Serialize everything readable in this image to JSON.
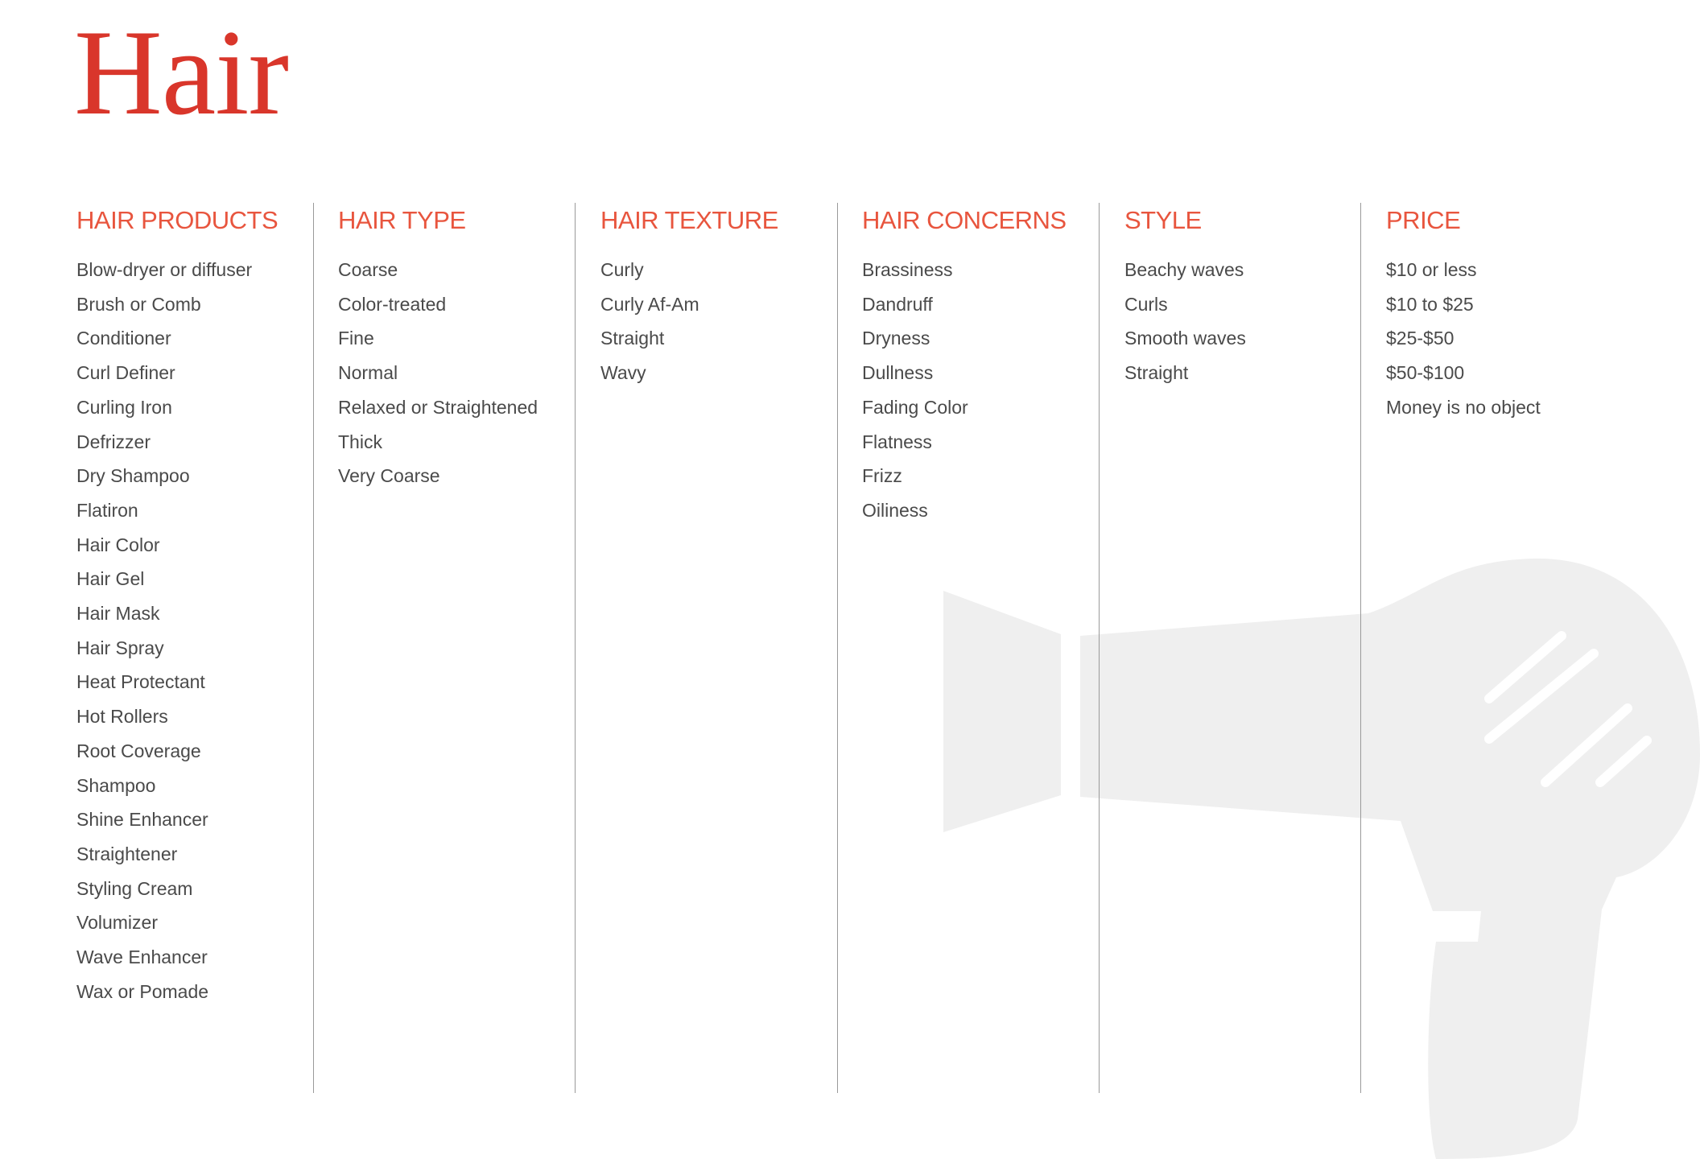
{
  "title": "Hair",
  "colors": {
    "title": "#d9362b",
    "heading": "#e8553e",
    "text": "#4a4a4a",
    "divider": "#9a9a9a",
    "watermark": "#efefef"
  },
  "watermark_icon": "hair-dryer-icon",
  "columns": [
    {
      "heading": "HAIR PRODUCTS",
      "items": [
        "Blow-dryer or diffuser",
        "Brush or Comb",
        "Conditioner",
        "Curl Definer",
        "Curling Iron",
        "Defrizzer",
        "Dry Shampoo",
        "Flatiron",
        "Hair Color",
        "Hair Gel",
        "Hair Mask",
        "Hair Spray",
        "Heat Protectant",
        "Hot Rollers",
        "Root Coverage",
        "Shampoo",
        "Shine Enhancer",
        "Straightener",
        "Styling Cream",
        "Volumizer",
        "Wave Enhancer",
        "Wax or Pomade"
      ]
    },
    {
      "heading": "HAIR TYPE",
      "items": [
        "Coarse",
        "Color-treated",
        "Fine",
        "Normal",
        "Relaxed or Straightened",
        "Thick",
        "Very Coarse"
      ]
    },
    {
      "heading": "HAIR TEXTURE",
      "items": [
        "Curly",
        "Curly Af-Am",
        "Straight",
        "Wavy"
      ]
    },
    {
      "heading": "HAIR CONCERNS",
      "items": [
        "Brassiness",
        "Dandruff",
        "Dryness",
        "Dullness",
        "Fading Color",
        "Flatness",
        "Frizz",
        "Oiliness"
      ]
    },
    {
      "heading": "STYLE",
      "items": [
        "Beachy waves",
        "Curls",
        "Smooth waves",
        "Straight"
      ]
    },
    {
      "heading": "PRICE",
      "items": [
        "$10 or less",
        "$10 to $25",
        "$25-$50",
        "$50-$100",
        "Money is no object"
      ]
    }
  ]
}
